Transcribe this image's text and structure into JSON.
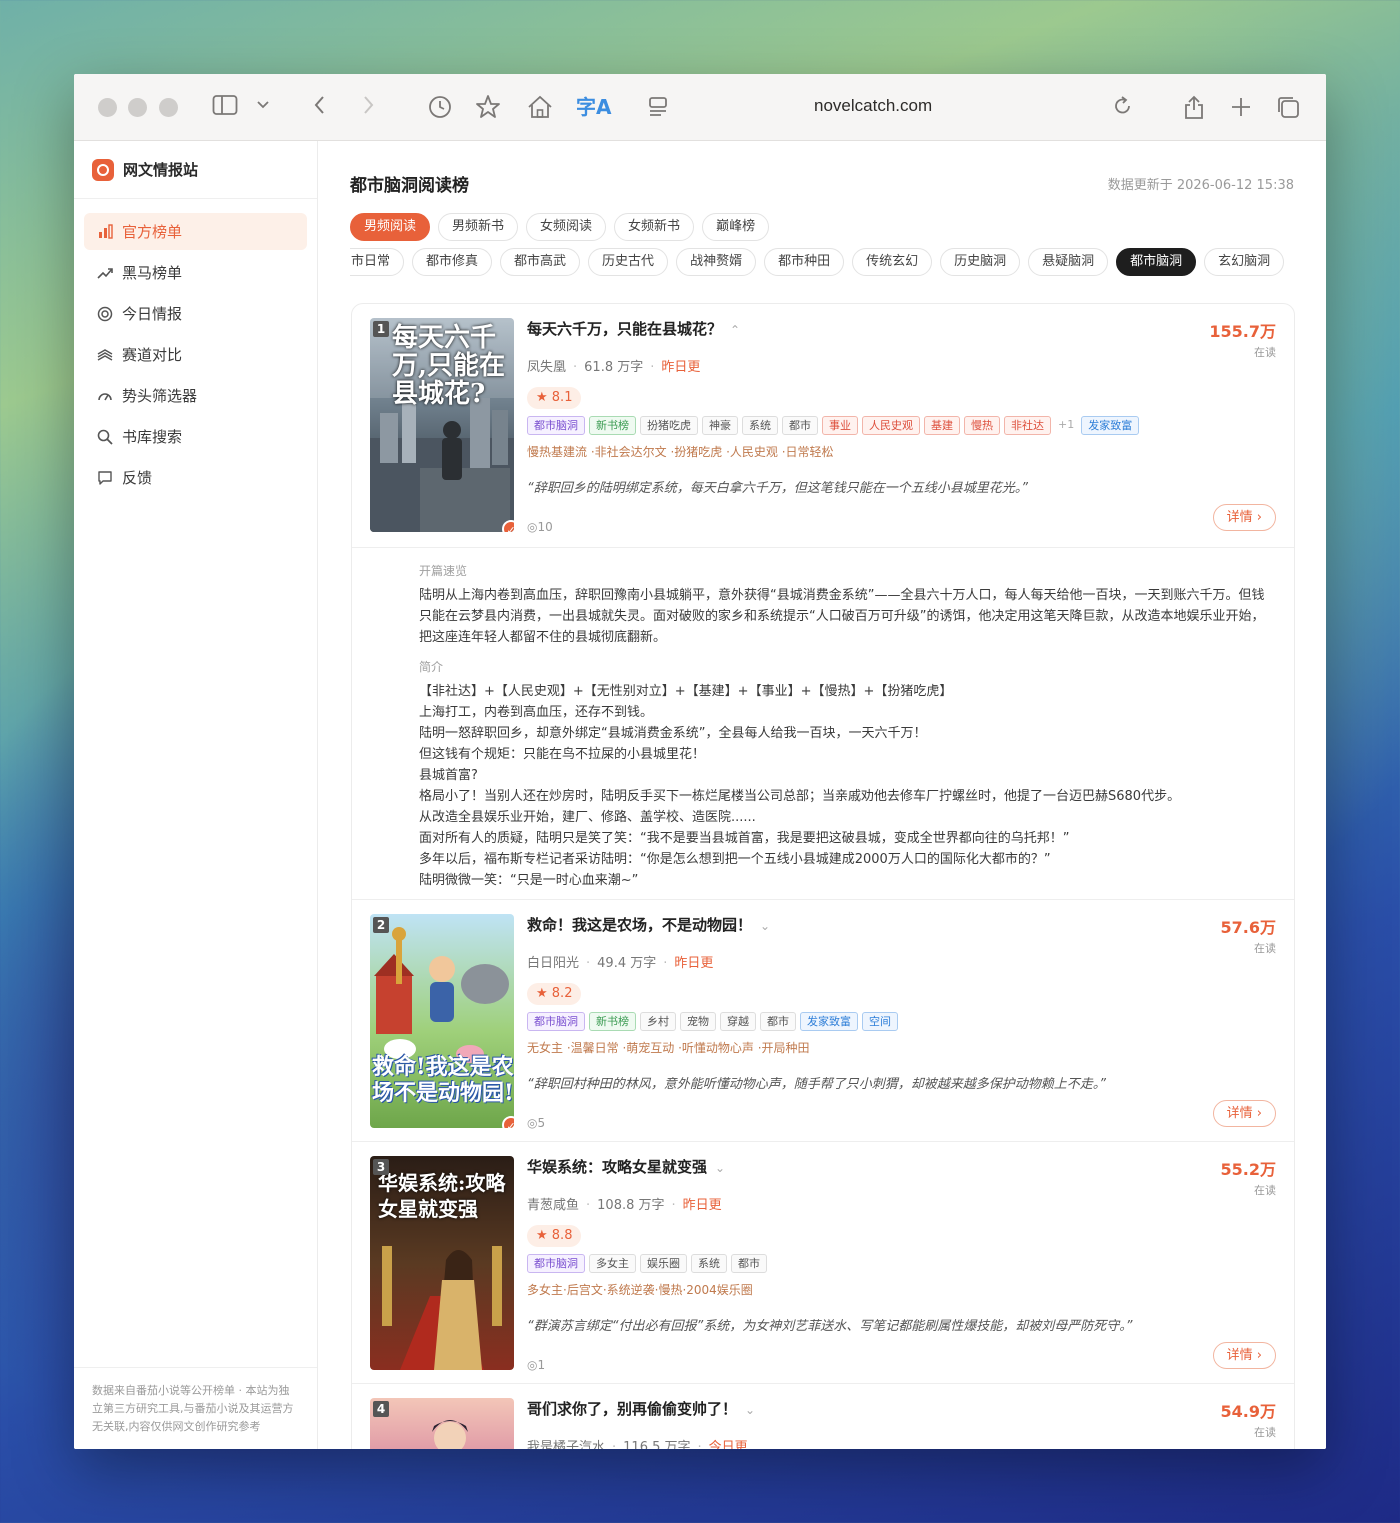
{
  "browser": {
    "url": "novelcatch.com"
  },
  "brand": {
    "name": "网文情报站"
  },
  "sidebar": {
    "items": [
      {
        "label": "官方榜单",
        "icon": "bar-chart-icon",
        "active": true
      },
      {
        "label": "黑马榜单",
        "icon": "trend-up-icon",
        "active": false
      },
      {
        "label": "今日情报",
        "icon": "target-icon",
        "active": false
      },
      {
        "label": "赛道对比",
        "icon": "layers-icon",
        "active": false
      },
      {
        "label": "势头筛选器",
        "icon": "gauge-icon",
        "active": false
      },
      {
        "label": "书库搜索",
        "icon": "search-icon",
        "active": false
      },
      {
        "label": "反馈",
        "icon": "message-icon",
        "active": false
      }
    ],
    "footer": "数据来自番茄小说等公开榜单 · 本站为独立第三方研究工具,与番茄小说及其运营方无关联,内容仅供网文创作研究参考"
  },
  "page": {
    "title": "都市脑洞阅读榜",
    "updated": "数据更新于 2026-06-12 15:38"
  },
  "gender_tabs": [
    "男频阅读",
    "男频新书",
    "女频阅读",
    "女频新书",
    "巅峰榜"
  ],
  "genre_tabs": [
    "市日常",
    "都市修真",
    "都市高武",
    "历史古代",
    "战神赘婿",
    "都市种田",
    "传统玄幻",
    "历史脑洞",
    "悬疑脑洞",
    "都市脑洞",
    "玄幻脑洞"
  ],
  "books": [
    {
      "rank": "1",
      "title": "每天六千万，只能在县城花？",
      "chevron": "⌃",
      "author": "凤失凰",
      "words": "61.8 万字",
      "update": "昨日更",
      "rating": "★ 8.1",
      "tags": [
        {
          "t": "都市脑洞",
          "c": "purple"
        },
        {
          "t": "新书榜",
          "c": "green"
        },
        {
          "t": "扮猪吃虎",
          "c": ""
        },
        {
          "t": "神豪",
          "c": ""
        },
        {
          "t": "系统",
          "c": ""
        },
        {
          "t": "都市",
          "c": ""
        },
        {
          "t": "事业",
          "c": "red"
        },
        {
          "t": "人民史观",
          "c": "red"
        },
        {
          "t": "基建",
          "c": "red"
        },
        {
          "t": "慢热",
          "c": "red"
        },
        {
          "t": "非社达",
          "c": "red"
        },
        {
          "t": "+1",
          "c": "plus"
        },
        {
          "t": "发家致富",
          "c": "blue"
        }
      ],
      "subtags": "慢热基建流 ·非社会达尔文 ·扮猪吃虎 ·人民史观 ·日常轻松",
      "quote": "“辞职回乡的陆明绑定系统，每天白拿六千万，但这笔钱只能在一个五线小县城里花光。”",
      "views": "10",
      "reads": "155.7万",
      "reads_label": "在读",
      "detail": "详情 ›",
      "cover_title": "每天六千万,只能在县城花?"
    },
    {
      "rank": "2",
      "title": "救命！我这是农场，不是动物园！",
      "chevron": "⌄",
      "author": "白日阳光",
      "words": "49.4 万字",
      "update": "昨日更",
      "rating": "★ 8.2",
      "tags": [
        {
          "t": "都市脑洞",
          "c": "purple"
        },
        {
          "t": "新书榜",
          "c": "green"
        },
        {
          "t": "乡村",
          "c": ""
        },
        {
          "t": "宠物",
          "c": ""
        },
        {
          "t": "穿越",
          "c": ""
        },
        {
          "t": "都市",
          "c": ""
        },
        {
          "t": "发家致富",
          "c": "blue"
        },
        {
          "t": "空间",
          "c": "blue"
        }
      ],
      "subtags": "无女主 ·温馨日常 ·萌宠互动 ·听懂动物心声 ·开局种田",
      "quote": "“辞职回村种田的林风，意外能听懂动物心声，随手帮了只小刺猬，却被越来越多保护动物赖上不走。”",
      "views": "5",
      "reads": "57.6万",
      "reads_label": "在读",
      "detail": "详情 ›",
      "cover_title": "救命!我这是农场不是动物园!"
    },
    {
      "rank": "3",
      "title": "华娱系统：攻略女星就变强",
      "chevron": "⌄",
      "author": "青葱咸鱼",
      "words": "108.8 万字",
      "update": "昨日更",
      "rating": "★ 8.8",
      "tags": [
        {
          "t": "都市脑洞",
          "c": "purple"
        },
        {
          "t": "多女主",
          "c": ""
        },
        {
          "t": "娱乐圈",
          "c": ""
        },
        {
          "t": "系统",
          "c": ""
        },
        {
          "t": "都市",
          "c": ""
        }
      ],
      "subtags": "多女主·后宫文·系统逆袭·慢热·2004娱乐圈",
      "quote": "“群演苏言绑定“付出必有回报”系统，为女神刘艺菲送水、写笔记都能刷属性爆技能，却被刘母严防死守。”",
      "views": "1",
      "reads": "55.2万",
      "reads_label": "在读",
      "detail": "详情 ›",
      "cover_title": "华娱系统:攻略女星就变强"
    },
    {
      "rank": "4",
      "title": "哥们求你了，别再偷偷变帅了！",
      "chevron": "⌄",
      "author": "我是橘子汽水",
      "words": "116.5 万字",
      "update": "今日更",
      "reads": "54.9万",
      "reads_label": "在读"
    }
  ],
  "expanded": {
    "opening_label": "开篇速览",
    "opening": "陆明从上海内卷到高血压，辞职回豫南小县城躺平，意外获得“县城消费金系统”——全县六十万人口，每人每天给他一百块，一天到账六千万。但钱只能在云梦县内消费，一出县城就失灵。面对破败的家乡和系统提示“人口破百万可升级”的诱饵，他决定用这笔天降巨款，从改造本地娱乐业开始，把这座连年轻人都留不住的县城彻底翻新。",
    "intro_label": "简介",
    "intro_lines": [
      "【非社达】+【人民史观】+【无性别对立】+【基建】+【事业】+【慢热】+【扮猪吃虎】",
      "上海打工，内卷到高血压，还存不到钱。",
      "陆明一怒辞职回乡，却意外绑定“县城消费金系统”，全县每人给我一百块，一天六千万！",
      "但这钱有个规矩：只能在鸟不拉屎的小县城里花！",
      "县城首富?",
      "格局小了！当别人还在炒房时，陆明反手买下一栋烂尾楼当公司总部；当亲戚劝他去修车厂拧螺丝时，他提了一台迈巴赫S680代步。",
      "从改造全县娱乐业开始，建厂、修路、盖学校、造医院......",
      "面对所有人的质疑，陆明只是笑了笑：“我不是要当县城首富，我是要把这破县城，变成全世界都向往的乌托邦！”",
      "多年以后，福布斯专栏记者采访陆明：“你是怎么想到把一个五线小县城建成2000万人口的国际化大都市的？”",
      "陆明微微一笑：“只是一时心血来潮~”"
    ]
  },
  "colors": {
    "accent": "#e8613a",
    "dark_chip": "#1e1e1e"
  }
}
